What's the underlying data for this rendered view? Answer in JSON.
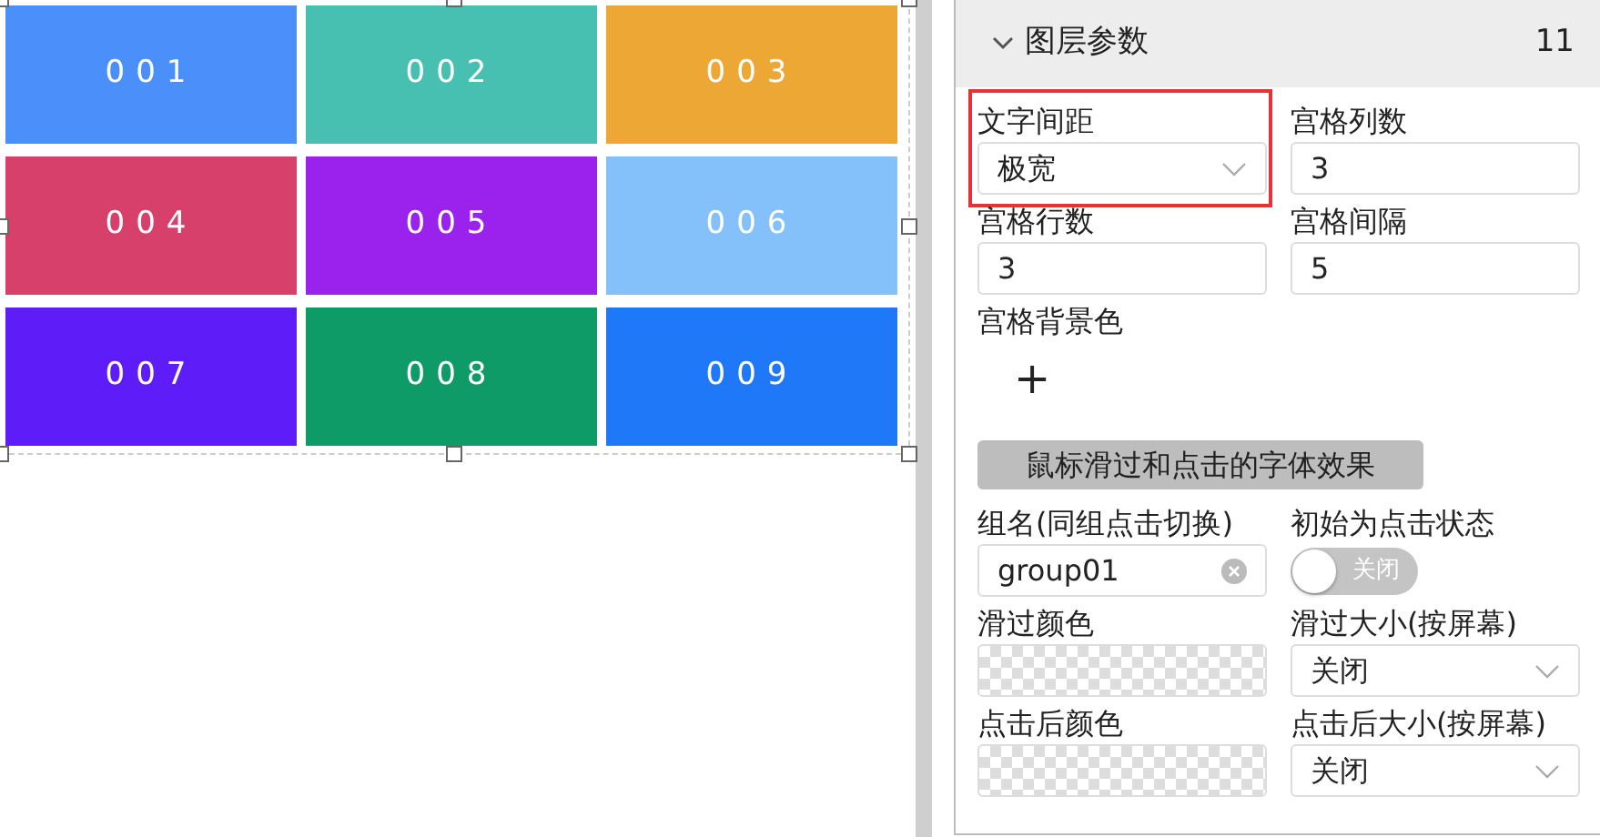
{
  "canvas": {
    "tiles": [
      {
        "label": "001",
        "color": "#4b8ffb"
      },
      {
        "label": "002",
        "color": "#47bfb1"
      },
      {
        "label": "003",
        "color": "#eda734"
      },
      {
        "label": "004",
        "color": "#d6406a"
      },
      {
        "label": "005",
        "color": "#9a22ec"
      },
      {
        "label": "006",
        "color": "#84c0f9"
      },
      {
        "label": "007",
        "color": "#5e1cf8"
      },
      {
        "label": "008",
        "color": "#0e9b67"
      },
      {
        "label": "009",
        "color": "#1e78f8"
      }
    ]
  },
  "panel": {
    "title": "图层参数",
    "count": "11",
    "expanded": true,
    "fields": [
      {
        "kind": "select",
        "label": "文字间距",
        "value": "极宽",
        "highlighted": true
      },
      {
        "kind": "input",
        "label": "宫格列数",
        "value": "3",
        "highlighted": false
      },
      {
        "kind": "input",
        "label": "宫格行数",
        "value": "3",
        "highlighted": false
      },
      {
        "kind": "input",
        "label": "宫格间隔",
        "value": "5",
        "highlighted": false
      },
      {
        "kind": "add",
        "label": "宫格背景色",
        "symbol": "+",
        "highlighted": false
      }
    ],
    "section_title": "鼠标滑过和点击的字体效果",
    "effects": [
      {
        "kind": "clearable",
        "label": "组名(同组点击切换)",
        "value": "group01"
      },
      {
        "kind": "switch",
        "label": "初始为点击状态",
        "on": false,
        "text": "关闭"
      },
      {
        "kind": "color",
        "label": "滑过颜色"
      },
      {
        "kind": "select",
        "label": "滑过大小(按屏幕)",
        "value": "关闭"
      },
      {
        "kind": "color",
        "label": "点击后颜色"
      },
      {
        "kind": "select",
        "label": "点击后大小(按屏幕)",
        "value": "关闭"
      }
    ]
  }
}
